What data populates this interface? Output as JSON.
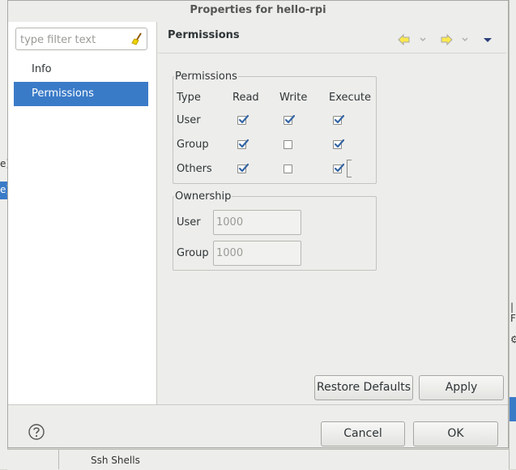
{
  "dialog": {
    "title": "Properties for hello-rpi"
  },
  "left_pane": {
    "filter_placeholder": "type filter text",
    "items": [
      {
        "label": "Info",
        "selected": false
      },
      {
        "label": "Permissions",
        "selected": true
      }
    ]
  },
  "page": {
    "title": "Permissions"
  },
  "permissions": {
    "group_label": "Permissions",
    "headers": [
      "Type",
      "Read",
      "Write",
      "Execute"
    ],
    "rows": [
      {
        "type": "User",
        "read": true,
        "write": true,
        "execute": true
      },
      {
        "type": "Group",
        "read": true,
        "write": false,
        "execute": true
      },
      {
        "type": "Others",
        "read": true,
        "write": false,
        "execute": true
      }
    ]
  },
  "ownership": {
    "group_label": "Ownership",
    "user_label": "User",
    "user_value": "1000",
    "group_label_field": "Group",
    "group_value": "1000"
  },
  "buttons": {
    "restore_defaults": "Restore Defaults",
    "apply": "Apply",
    "cancel": "Cancel",
    "ok": "OK"
  },
  "background": {
    "left_text_1": "e]",
    "left_text_2": "e]",
    "right_text_1": "| F",
    "right_text_2": "⚙",
    "bottom_text": "Ssh Shells"
  },
  "colors": {
    "selection": "#3a7bc8",
    "check": "#3465a4"
  }
}
